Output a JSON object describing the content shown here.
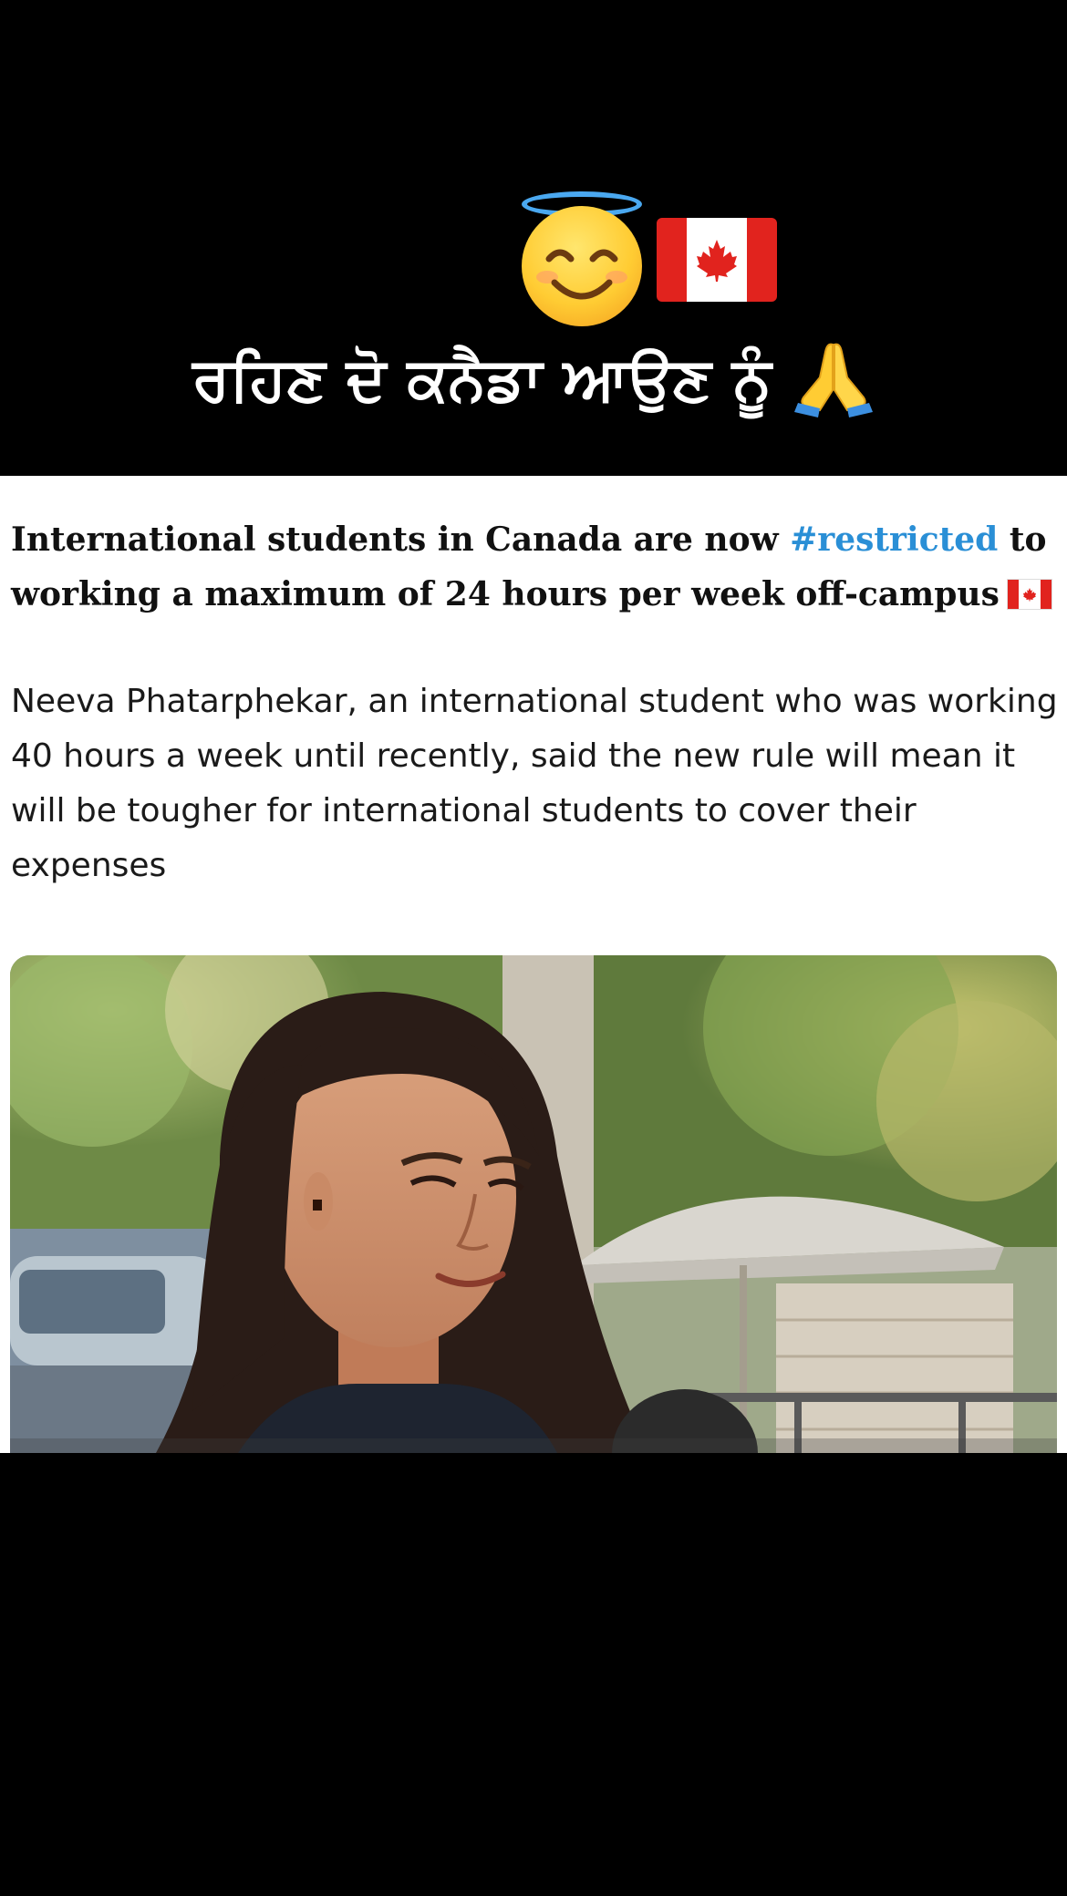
{
  "overlay": {
    "halo_icon": "smiling-face-with-halo",
    "flag_icon": "flag-canada",
    "title_punjabi": "ਰਹਿਣ ਦੋ ਕਨੈਡਾ ਆਉਣ ਨੂੰ",
    "pray_icon": "folded-hands"
  },
  "post": {
    "headline_part1": "International students in Canada are now ",
    "hashtag": "#restricted",
    "headline_part2": " to working a maximum of 24 hours per week off-campus",
    "headline_flag_icon": "flag-canada",
    "body": "Neeva Phatarphekar, an international student who was working 40 hours a week until recently, said the new rule will mean it will be tougher for international students to cover their expenses",
    "image_subject": "photo of a young woman being interviewed outdoors on a street with a patio umbrella"
  },
  "colors": {
    "background": "#000000",
    "card": "#ffffff",
    "hashtag": "#2a8fd6",
    "flag_red": "#e1231e"
  }
}
